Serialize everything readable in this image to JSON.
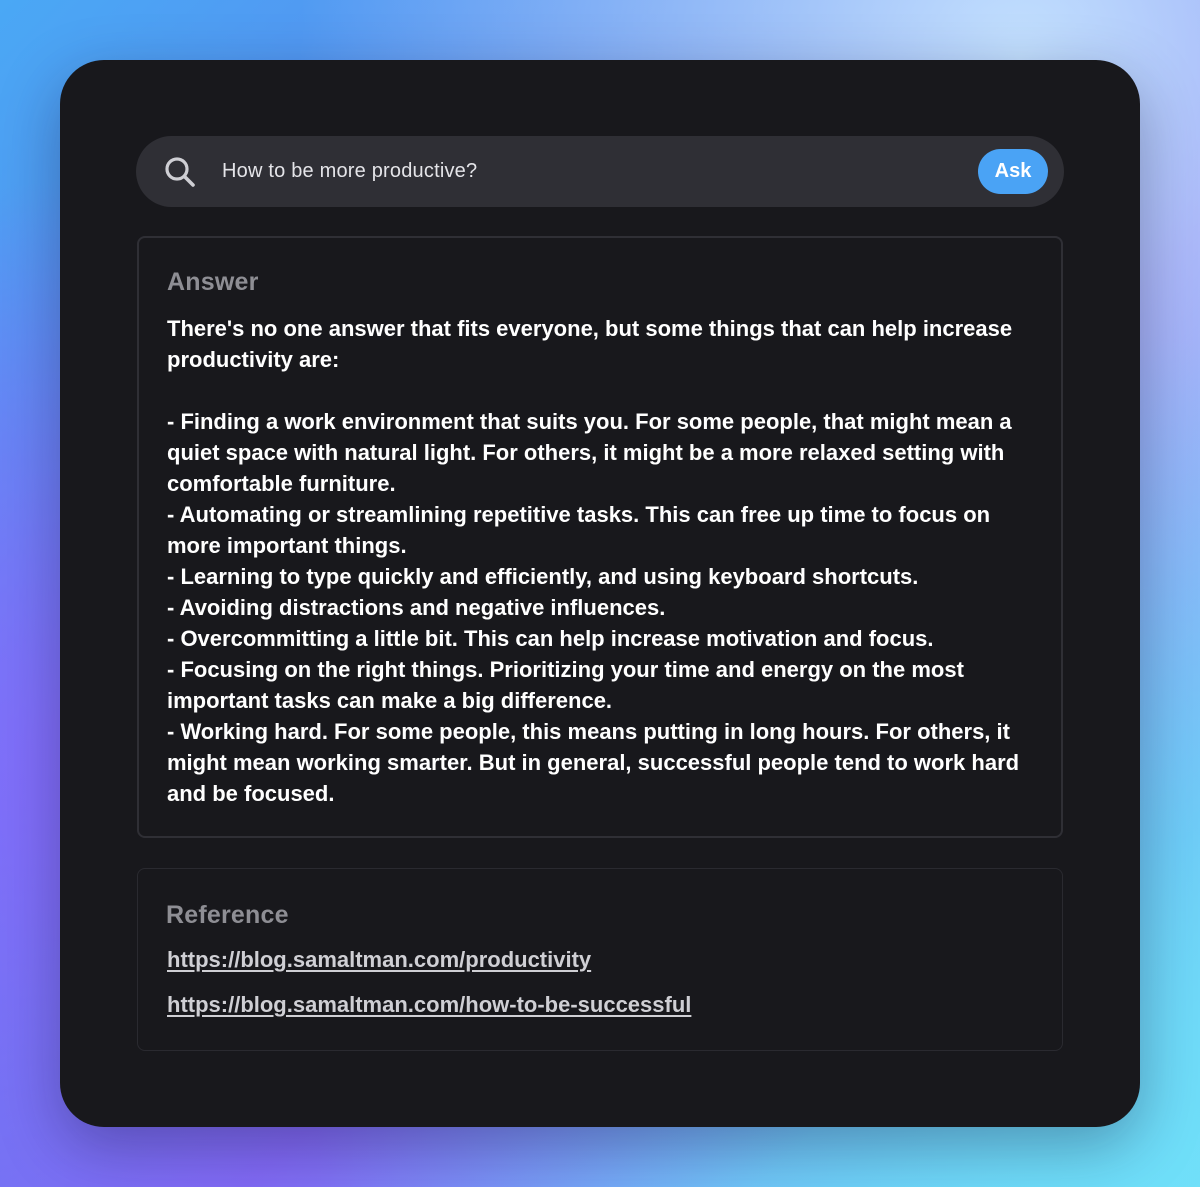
{
  "search": {
    "value": "How to be more productive?",
    "button_label": "Ask"
  },
  "answer": {
    "title": "Answer",
    "body": "There's no one answer that fits everyone, but some things that can help increase productivity are:\n\n- Finding a work environment that suits you. For some people, that might mean a quiet space with natural light. For others, it might be a more relaxed setting with comfortable furniture.\n- Automating or streamlining repetitive tasks. This can free up time to focus on more important things.\n- Learning to type quickly and efficiently, and using keyboard shortcuts.\n- Avoiding distractions and negative influences.\n- Overcommitting a little bit. This can help increase motivation and focus.\n- Focusing on the right things. Prioritizing your time and energy on the most important tasks can make a big difference.\n- Working hard. For some people, this means putting in long hours. For others, it might mean working smarter. But in general, successful people tend to work hard and be focused."
  },
  "reference": {
    "title": "Reference",
    "links": [
      "https://blog.samaltman.com/productivity",
      "https://blog.samaltman.com/how-to-be-successful"
    ]
  },
  "icons": {
    "search": "search-icon"
  },
  "colors": {
    "panel_background": "#18181c",
    "search_background": "#2f2f35",
    "accent": "#4aa3f5",
    "title_text": "#8e8e94",
    "body_text": "#ffffff",
    "link_text": "#cfcfd4"
  }
}
